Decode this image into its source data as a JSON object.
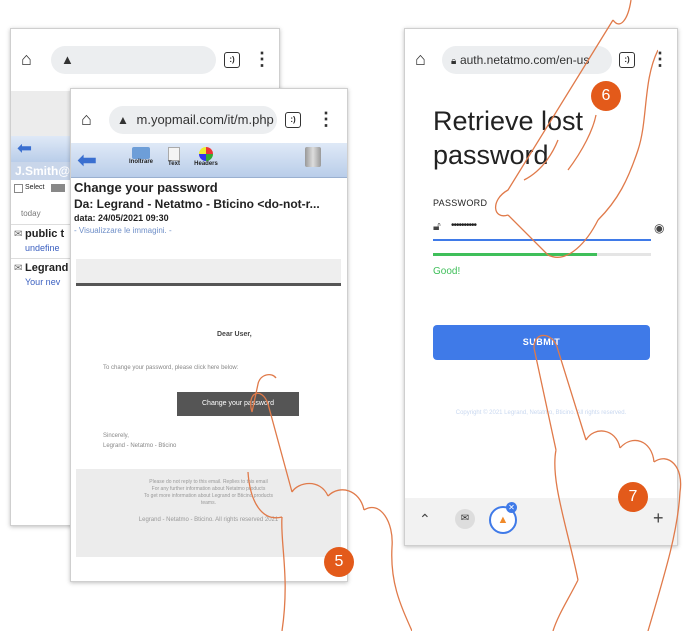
{
  "phone_back": {
    "brand": "J.Smith@",
    "select_label": "Select",
    "today_label": "today",
    "items": [
      {
        "title": "public t",
        "sub": "undefine"
      },
      {
        "title": "Legrand",
        "sub": "Your nev"
      }
    ]
  },
  "phone_mid": {
    "url": "m.yopmail.com/it/m.php",
    "toolbar": {
      "forward": "Inoltrare",
      "text": "Text",
      "headers": "Headers"
    },
    "subject": "Change your password",
    "from": "Da: Legrand - Netatmo - Bticino <do-not-r...",
    "date_label": "data:",
    "date_value": "24/05/2021 09:30",
    "images_link": "- Visualizzare le immagini. -",
    "email": {
      "greeting": "Dear User,",
      "instruction": "To change your password, please click here below:",
      "button": "Change your password",
      "sign1": "Sincerely,",
      "sign2": "Legrand - Netatmo - Bticino",
      "footer1": "Please do not reply to this email. Replies to this email",
      "footer2": "For any further information about Netatmo products",
      "footer3": "To get more information about Legrand or Bticino products",
      "footer4": "teams.",
      "footer5": "Legrand - Netatmo - Bticino. All rights reserved 2021"
    }
  },
  "phone_right": {
    "url": "auth.netatmo.com/en-us",
    "heading1": "Retrieve lost",
    "heading2": "password",
    "password_label": "PASSWORD",
    "password_value": "••••••••••",
    "strength_text": "Good!",
    "strength_level": 0.75,
    "submit": "SUBMIT",
    "copyright": "Copyright © 2021 Legrand, Netatmo, Bticino. All rights reserved."
  },
  "badges": [
    "5",
    "6",
    "7"
  ],
  "colors": {
    "accent_blue": "#3f7ae8",
    "strength_green": "#3fbf5a",
    "badge_orange": "#e35a1a"
  }
}
